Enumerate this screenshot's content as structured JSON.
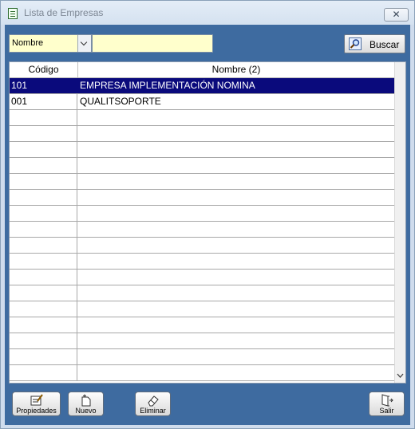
{
  "window": {
    "title": "Lista de Empresas",
    "close_glyph": "✕"
  },
  "filter": {
    "field_selected": "Nombre",
    "search_value": "",
    "search_label": "Buscar"
  },
  "table": {
    "columns": [
      "Código",
      "Nombre (2)"
    ],
    "rows": [
      {
        "code": "101",
        "name": "EMPRESA IMPLEMENTACIÓN NOMINA",
        "selected": true
      },
      {
        "code": "001",
        "name": "QUALITSOPORTE",
        "selected": false
      }
    ],
    "empty_rows": 17
  },
  "footer": {
    "buttons": [
      {
        "name": "propiedades-button",
        "icon": "properties-icon",
        "label": "Propiedades"
      },
      {
        "name": "nuevo-button",
        "icon": "new-document-icon",
        "label": "Nuevo"
      },
      {
        "name": "eliminar-button",
        "icon": "eraser-icon",
        "label": "Eliminar"
      },
      {
        "name": "salir-button",
        "icon": "exit-door-icon",
        "label": "Salir"
      }
    ]
  },
  "colors": {
    "frame": "#3e6ba0",
    "selection": "#0a0a7c",
    "input_bg": "#ffffcc"
  }
}
